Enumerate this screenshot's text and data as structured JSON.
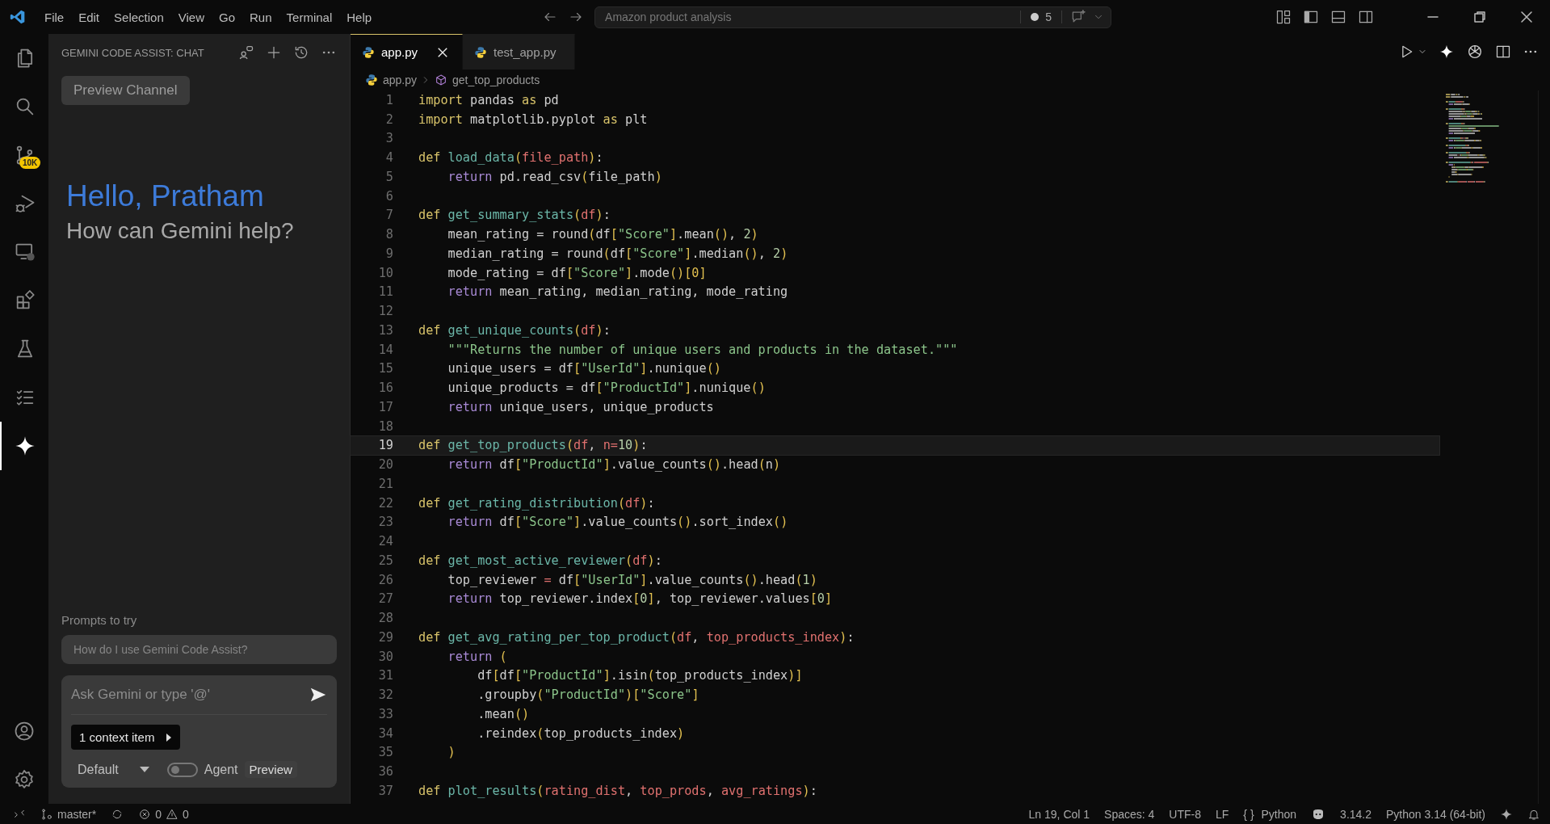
{
  "title_bar": {
    "menu": [
      "File",
      "Edit",
      "Selection",
      "View",
      "Go",
      "Run",
      "Terminal",
      "Help"
    ],
    "search": {
      "value": "Amazon product analysis"
    },
    "changes_count": "5"
  },
  "activity_bar": {
    "items": [
      {
        "kind": "files",
        "selected": false
      },
      {
        "kind": "search",
        "selected": false
      },
      {
        "kind": "source-control",
        "selected": false,
        "badge": "10K"
      },
      {
        "kind": "run-debug",
        "selected": false
      },
      {
        "kind": "remote",
        "selected": false
      },
      {
        "kind": "extensions",
        "selected": false
      },
      {
        "kind": "testing",
        "selected": false
      },
      {
        "kind": "list",
        "selected": false
      },
      {
        "kind": "sparkle",
        "selected": true
      }
    ],
    "bottom": [
      {
        "kind": "account"
      },
      {
        "kind": "settings"
      }
    ]
  },
  "side_panel": {
    "title": "GEMINI CODE ASSIST: CHAT",
    "channel_button": "Preview Channel",
    "greeting": "Hello, Pratham",
    "subtitle": "How can Gemini help?",
    "prompts_label": "Prompts to try",
    "prompts": [
      "How do I use Gemini Code Assist?"
    ],
    "input": {
      "placeholder": "Ask Gemini or type '@'"
    },
    "context_button": "1 context item",
    "mode": "Default",
    "agent": {
      "label": "Agent",
      "on": false,
      "tag": "Preview"
    }
  },
  "tabs": [
    {
      "label": "app.py",
      "selected": true
    },
    {
      "label": "test_app.py",
      "selected": false
    }
  ],
  "breadcrumb": [
    "app.py",
    "get_top_products"
  ],
  "editor": {
    "lines": [
      {
        "number": "1",
        "selected": false,
        "tokens": [
          {
            "kind": "keyword",
            "text": "import "
          },
          {
            "kind": "plain",
            "text": "pandas "
          },
          {
            "kind": "keyword",
            "text": "as "
          },
          {
            "kind": "plain",
            "text": "pd"
          }
        ]
      },
      {
        "number": "2",
        "selected": false,
        "tokens": [
          {
            "kind": "keyword",
            "text": "import "
          },
          {
            "kind": "plain",
            "text": "matplotlib.pyplot "
          },
          {
            "kind": "keyword",
            "text": "as "
          },
          {
            "kind": "plain",
            "text": "plt"
          }
        ]
      },
      {
        "number": "3",
        "selected": false
      },
      {
        "number": "4",
        "selected": false,
        "tokens": [
          {
            "kind": "keyword",
            "text": "def "
          },
          {
            "kind": "function",
            "text": "load_data"
          },
          {
            "kind": "bracket",
            "text": "("
          },
          {
            "kind": "param",
            "text": "file_path"
          },
          {
            "kind": "bracket",
            "text": ")"
          },
          {
            "kind": "plain",
            "text": ":"
          }
        ]
      },
      {
        "number": "5",
        "selected": false,
        "tokens": [
          {
            "kind": "control",
            "text": "    return "
          },
          {
            "kind": "plain",
            "text": "pd.read_csv"
          },
          {
            "kind": "bracket",
            "text": "("
          },
          {
            "kind": "plain",
            "text": "file_path"
          },
          {
            "kind": "bracket",
            "text": ")"
          }
        ]
      },
      {
        "number": "6",
        "selected": false
      },
      {
        "number": "7",
        "selected": false,
        "tokens": [
          {
            "kind": "keyword",
            "text": "def "
          },
          {
            "kind": "function",
            "text": "get_summary_stats"
          },
          {
            "kind": "bracket",
            "text": "("
          },
          {
            "kind": "param",
            "text": "df"
          },
          {
            "kind": "bracket",
            "text": ")"
          },
          {
            "kind": "plain",
            "text": ":"
          }
        ]
      },
      {
        "number": "8",
        "selected": false,
        "tokens": [
          {
            "kind": "plain",
            "text": "    mean_rating = round"
          },
          {
            "kind": "bracket",
            "text": "("
          },
          {
            "kind": "plain",
            "text": "df"
          },
          {
            "kind": "bracket",
            "text": "["
          },
          {
            "kind": "string",
            "text": "\"Score\""
          },
          {
            "kind": "bracket",
            "text": "]"
          },
          {
            "kind": "plain",
            "text": ".mean"
          },
          {
            "kind": "bracket",
            "text": "()"
          },
          {
            "kind": "plain",
            "text": ", "
          },
          {
            "kind": "number",
            "text": "2"
          },
          {
            "kind": "bracket",
            "text": ")"
          }
        ]
      },
      {
        "number": "9",
        "selected": false,
        "tokens": [
          {
            "kind": "plain",
            "text": "    median_rating = round"
          },
          {
            "kind": "bracket",
            "text": "("
          },
          {
            "kind": "plain",
            "text": "df"
          },
          {
            "kind": "bracket",
            "text": "["
          },
          {
            "kind": "string",
            "text": "\"Score\""
          },
          {
            "kind": "bracket",
            "text": "]"
          },
          {
            "kind": "plain",
            "text": ".median"
          },
          {
            "kind": "bracket",
            "text": "()"
          },
          {
            "kind": "plain",
            "text": ", "
          },
          {
            "kind": "number",
            "text": "2"
          },
          {
            "kind": "bracket",
            "text": ")"
          }
        ]
      },
      {
        "number": "10",
        "selected": false,
        "tokens": [
          {
            "kind": "plain",
            "text": "    mode_rating = df"
          },
          {
            "kind": "bracket",
            "text": "["
          },
          {
            "kind": "string",
            "text": "\"Score\""
          },
          {
            "kind": "bracket",
            "text": "]"
          },
          {
            "kind": "plain",
            "text": ".mode"
          },
          {
            "kind": "bracket",
            "text": "()[0]"
          }
        ]
      },
      {
        "number": "11",
        "selected": false,
        "tokens": [
          {
            "kind": "control",
            "text": "    return "
          },
          {
            "kind": "plain",
            "text": "mean_rating, median_rating, mode_rating"
          }
        ]
      },
      {
        "number": "12",
        "selected": false
      },
      {
        "number": "13",
        "selected": false,
        "tokens": [
          {
            "kind": "keyword",
            "text": "def "
          },
          {
            "kind": "function",
            "text": "get_unique_counts"
          },
          {
            "kind": "bracket",
            "text": "("
          },
          {
            "kind": "param",
            "text": "df"
          },
          {
            "kind": "bracket",
            "text": ")"
          },
          {
            "kind": "plain",
            "text": ":"
          }
        ]
      },
      {
        "number": "14",
        "selected": false,
        "tokens": [
          {
            "kind": "string",
            "text": "    \"\"\"Returns the number of unique users and products in the dataset.\"\"\""
          }
        ]
      },
      {
        "number": "15",
        "selected": false,
        "tokens": [
          {
            "kind": "plain",
            "text": "    unique_users = df"
          },
          {
            "kind": "bracket",
            "text": "["
          },
          {
            "kind": "string",
            "text": "\"UserId\""
          },
          {
            "kind": "bracket",
            "text": "]"
          },
          {
            "kind": "plain",
            "text": ".nunique"
          },
          {
            "kind": "bracket",
            "text": "()"
          }
        ]
      },
      {
        "number": "16",
        "selected": false,
        "tokens": [
          {
            "kind": "plain",
            "text": "    unique_products = df"
          },
          {
            "kind": "bracket",
            "text": "["
          },
          {
            "kind": "string",
            "text": "\"ProductId\""
          },
          {
            "kind": "bracket",
            "text": "]"
          },
          {
            "kind": "plain",
            "text": ".nunique"
          },
          {
            "kind": "bracket",
            "text": "()"
          }
        ]
      },
      {
        "number": "17",
        "selected": false,
        "tokens": [
          {
            "kind": "control",
            "text": "    return "
          },
          {
            "kind": "plain",
            "text": "unique_users, unique_products"
          }
        ]
      },
      {
        "number": "18",
        "selected": false
      },
      {
        "number": "19",
        "selected": true,
        "tokens": [
          {
            "kind": "keyword",
            "text": "def "
          },
          {
            "kind": "function",
            "text": "get_top_products"
          },
          {
            "kind": "bracket",
            "text": "("
          },
          {
            "kind": "param",
            "text": "df"
          },
          {
            "kind": "plain",
            "text": ", "
          },
          {
            "kind": "param",
            "text": "n"
          },
          {
            "kind": "operator",
            "text": "="
          },
          {
            "kind": "number",
            "text": "10"
          },
          {
            "kind": "bracket",
            "text": ")"
          },
          {
            "kind": "plain",
            "text": ":"
          }
        ]
      },
      {
        "number": "20",
        "selected": false,
        "tokens": [
          {
            "kind": "control",
            "text": "    return "
          },
          {
            "kind": "plain",
            "text": "df"
          },
          {
            "kind": "bracket",
            "text": "["
          },
          {
            "kind": "string",
            "text": "\"ProductId\""
          },
          {
            "kind": "bracket",
            "text": "]"
          },
          {
            "kind": "plain",
            "text": ".value_counts"
          },
          {
            "kind": "bracket",
            "text": "()"
          },
          {
            "kind": "plain",
            "text": ".head"
          },
          {
            "kind": "bracket",
            "text": "("
          },
          {
            "kind": "plain",
            "text": "n"
          },
          {
            "kind": "bracket",
            "text": ")"
          }
        ]
      },
      {
        "number": "21",
        "selected": false
      },
      {
        "number": "22",
        "selected": false,
        "tokens": [
          {
            "kind": "keyword",
            "text": "def "
          },
          {
            "kind": "function",
            "text": "get_rating_distribution"
          },
          {
            "kind": "bracket",
            "text": "("
          },
          {
            "kind": "param",
            "text": "df"
          },
          {
            "kind": "bracket",
            "text": ")"
          },
          {
            "kind": "plain",
            "text": ":"
          }
        ]
      },
      {
        "number": "23",
        "selected": false,
        "tokens": [
          {
            "kind": "control",
            "text": "    return "
          },
          {
            "kind": "plain",
            "text": "df"
          },
          {
            "kind": "bracket",
            "text": "["
          },
          {
            "kind": "string",
            "text": "\"Score\""
          },
          {
            "kind": "bracket",
            "text": "]"
          },
          {
            "kind": "plain",
            "text": ".value_counts"
          },
          {
            "kind": "bracket",
            "text": "()"
          },
          {
            "kind": "plain",
            "text": ".sort_index"
          },
          {
            "kind": "bracket",
            "text": "()"
          }
        ]
      },
      {
        "number": "24",
        "selected": false
      },
      {
        "number": "25",
        "selected": false,
        "tokens": [
          {
            "kind": "keyword",
            "text": "def "
          },
          {
            "kind": "function",
            "text": "get_most_active_reviewer"
          },
          {
            "kind": "bracket",
            "text": "("
          },
          {
            "kind": "param",
            "text": "df"
          },
          {
            "kind": "bracket",
            "text": ")"
          },
          {
            "kind": "plain",
            "text": ":"
          }
        ]
      },
      {
        "number": "26",
        "selected": false,
        "tokens": [
          {
            "kind": "plain",
            "text": "    top_reviewer "
          },
          {
            "kind": "operator",
            "text": "="
          },
          {
            "kind": "plain",
            "text": " df"
          },
          {
            "kind": "bracket",
            "text": "["
          },
          {
            "kind": "string",
            "text": "\"UserId\""
          },
          {
            "kind": "bracket",
            "text": "]"
          },
          {
            "kind": "plain",
            "text": ".value_counts"
          },
          {
            "kind": "bracket",
            "text": "()"
          },
          {
            "kind": "plain",
            "text": ".head"
          },
          {
            "kind": "bracket",
            "text": "("
          },
          {
            "kind": "number",
            "text": "1"
          },
          {
            "kind": "bracket",
            "text": ")"
          }
        ]
      },
      {
        "number": "27",
        "selected": false,
        "tokens": [
          {
            "kind": "control",
            "text": "    return "
          },
          {
            "kind": "plain",
            "text": "top_reviewer.index"
          },
          {
            "kind": "bracket",
            "text": "["
          },
          {
            "kind": "number",
            "text": "0"
          },
          {
            "kind": "bracket",
            "text": "]"
          },
          {
            "kind": "plain",
            "text": ", top_reviewer.values"
          },
          {
            "kind": "bracket",
            "text": "["
          },
          {
            "kind": "number",
            "text": "0"
          },
          {
            "kind": "bracket",
            "text": "]"
          }
        ]
      },
      {
        "number": "28",
        "selected": false
      },
      {
        "number": "29",
        "selected": false,
        "tokens": [
          {
            "kind": "keyword",
            "text": "def "
          },
          {
            "kind": "function",
            "text": "get_avg_rating_per_top_product"
          },
          {
            "kind": "bracket",
            "text": "("
          },
          {
            "kind": "param",
            "text": "df"
          },
          {
            "kind": "plain",
            "text": ", "
          },
          {
            "kind": "param",
            "text": "top_products_index"
          },
          {
            "kind": "bracket",
            "text": ")"
          },
          {
            "kind": "plain",
            "text": ":"
          }
        ]
      },
      {
        "number": "30",
        "selected": false,
        "tokens": [
          {
            "kind": "control",
            "text": "    return "
          },
          {
            "kind": "bracket",
            "text": "("
          }
        ]
      },
      {
        "number": "31",
        "selected": false,
        "tokens": [
          {
            "kind": "plain",
            "text": "        df"
          },
          {
            "kind": "bracket",
            "text": "["
          },
          {
            "kind": "plain",
            "text": "df"
          },
          {
            "kind": "bracket",
            "text": "["
          },
          {
            "kind": "string",
            "text": "\"ProductId\""
          },
          {
            "kind": "bracket",
            "text": "]"
          },
          {
            "kind": "plain",
            "text": ".isin"
          },
          {
            "kind": "bracket",
            "text": "("
          },
          {
            "kind": "plain",
            "text": "top_products_index"
          },
          {
            "kind": "bracket",
            "text": ")]"
          }
        ]
      },
      {
        "number": "32",
        "selected": false,
        "tokens": [
          {
            "kind": "plain",
            "text": "        .groupby"
          },
          {
            "kind": "bracket",
            "text": "("
          },
          {
            "kind": "string",
            "text": "\"ProductId\""
          },
          {
            "kind": "bracket",
            "text": ")["
          },
          {
            "kind": "string",
            "text": "\"Score\""
          },
          {
            "kind": "bracket",
            "text": "]"
          }
        ]
      },
      {
        "number": "33",
        "selected": false,
        "tokens": [
          {
            "kind": "plain",
            "text": "        .mean"
          },
          {
            "kind": "bracket",
            "text": "()"
          }
        ]
      },
      {
        "number": "34",
        "selected": false,
        "tokens": [
          {
            "kind": "plain",
            "text": "        .reindex"
          },
          {
            "kind": "bracket",
            "text": "("
          },
          {
            "kind": "plain",
            "text": "top_products_index"
          },
          {
            "kind": "bracket",
            "text": ")"
          }
        ]
      },
      {
        "number": "35",
        "selected": false,
        "tokens": [
          {
            "kind": "bracket",
            "text": "    )"
          }
        ]
      },
      {
        "number": "36",
        "selected": false
      },
      {
        "number": "37",
        "selected": false,
        "tokens": [
          {
            "kind": "keyword",
            "text": "def "
          },
          {
            "kind": "function",
            "text": "plot_results"
          },
          {
            "kind": "bracket",
            "text": "("
          },
          {
            "kind": "param",
            "text": "rating_dist"
          },
          {
            "kind": "plain",
            "text": ", "
          },
          {
            "kind": "param",
            "text": "top_prods"
          },
          {
            "kind": "plain",
            "text": ", "
          },
          {
            "kind": "param",
            "text": "avg_ratings"
          },
          {
            "kind": "bracket",
            "text": ")"
          },
          {
            "kind": "plain",
            "text": ":"
          }
        ]
      }
    ]
  },
  "status_bar": {
    "branch": "master*",
    "errors": "0",
    "warnings": "0",
    "items": [
      "Ln 19, Col 1",
      "Spaces: 4",
      "UTF-8",
      "LF"
    ],
    "language_icon": "{ }",
    "language": "Python",
    "version": "3.14.2",
    "interpreter": "Python 3.14 (64-bit)"
  }
}
